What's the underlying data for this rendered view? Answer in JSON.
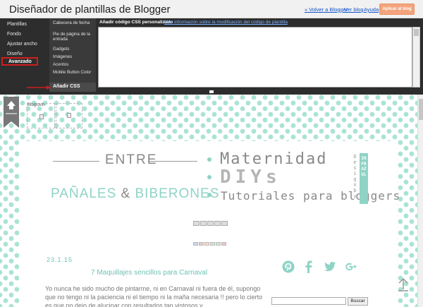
{
  "header": {
    "title": "Diseñador de plantillas de Blogger",
    "back_link": "« Volver a Blogger",
    "view_blog": "Ver blog",
    "help": "Ayuda",
    "apply_button": "Aplicar al blog"
  },
  "sidebar": {
    "items": [
      {
        "label": "Plantillas"
      },
      {
        "label": "Fondo"
      },
      {
        "label": "Ajustar ancho"
      },
      {
        "label": "Diseño"
      },
      {
        "label": "Avanzado"
      }
    ]
  },
  "subnav": {
    "items": [
      {
        "label": "Cabecera de fecha"
      },
      {
        "label": "Pie de página de la entrada"
      },
      {
        "label": "Gadgets"
      },
      {
        "label": "Imágenes"
      },
      {
        "label": "Acentos"
      },
      {
        "label": "Mobile Button Color"
      },
      {
        "label": "Añadir CSS"
      }
    ]
  },
  "css_editor": {
    "label": "Añadir código CSS personalizado",
    "info_link": "Más información sobre la modificación del código de plantilla",
    "value": ""
  },
  "preview": {
    "widget_label": "Bloglovin",
    "logo": {
      "entre": "ENTRE",
      "panales": "PAÑALES",
      "amp": "&",
      "biberones": "BIBERONES",
      "maternidad": "Maternidad",
      "diys": "DIYs",
      "tutoriales": "Tutoriales para bloggers",
      "design_by": "Design by",
      "tag": "INFRAZUL"
    },
    "post": {
      "date": "23.1.15",
      "title": "7 Maquillajes sencillos para Carnaval",
      "text": "Yo nunca he sido mucho de pintarme, ni en Carnaval ni fuera de él, supongo que no tengo ni la paciencia ni el tiempo ni la maña necesaria !! pero lo cierto es que no dejo de alucinar con resultados tan vistosos y"
    },
    "social_icons": [
      "pinterest-icon",
      "facebook-icon",
      "twitter-icon",
      "google-plus-icon"
    ],
    "search": {
      "placeholder": "",
      "button": "Buscar"
    }
  },
  "colors": {
    "accent": "#8fd3c6",
    "dots": "#a9e3d4",
    "panel": "#2d2d2d",
    "apply": "#f3a47c",
    "highlight": "#d21d1d"
  }
}
